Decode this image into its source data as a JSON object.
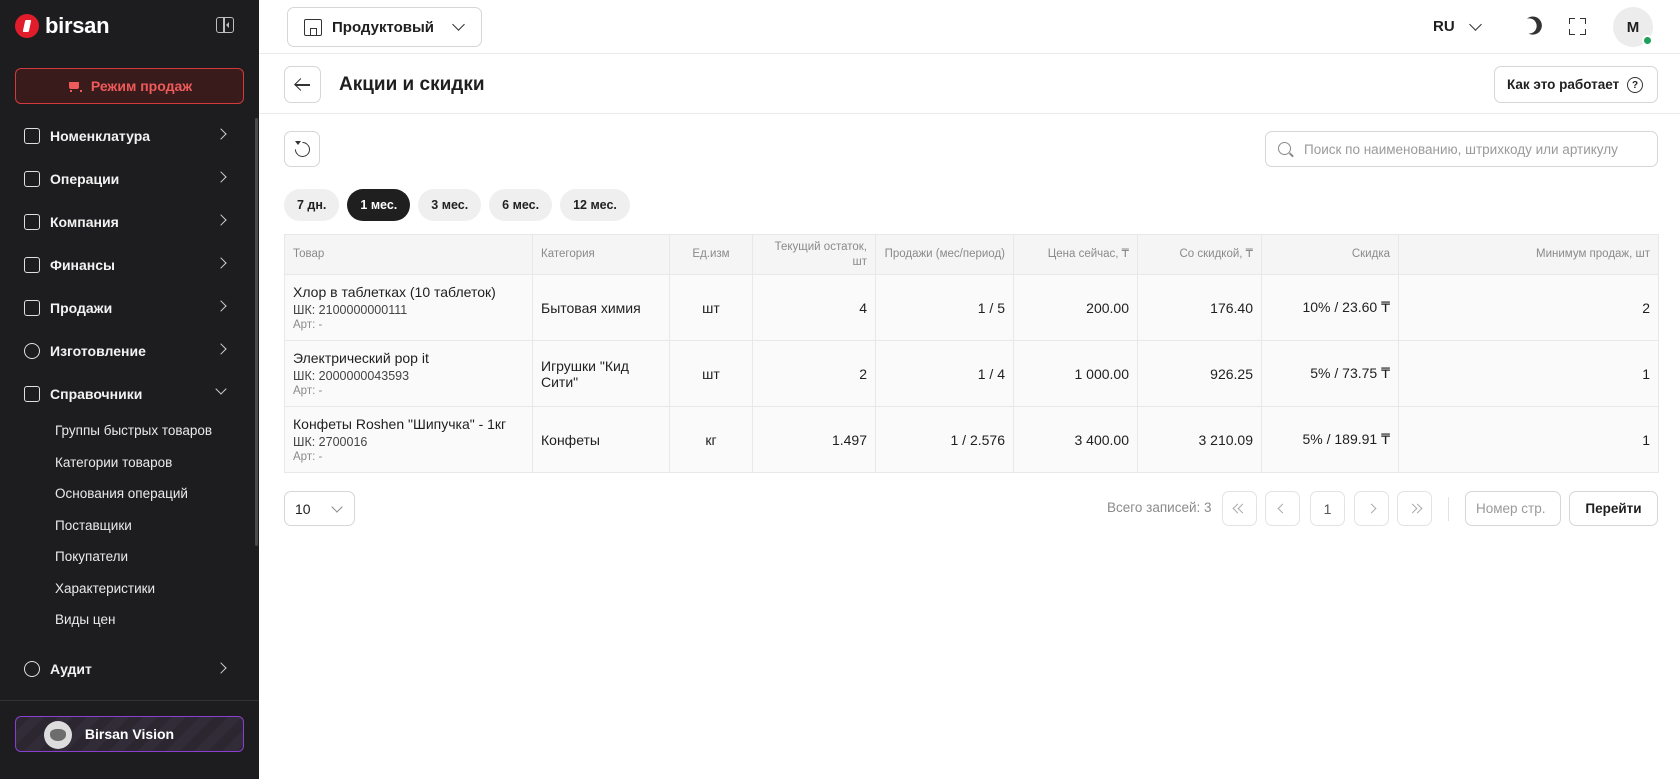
{
  "sidebar": {
    "logo": "birsan",
    "sales_mode": "Режим продаж",
    "menu": [
      {
        "label": "Номенклатура",
        "icon": "box-icon"
      },
      {
        "label": "Операции",
        "icon": "layers-icon"
      },
      {
        "label": "Компания",
        "icon": "briefcase-icon"
      },
      {
        "label": "Финансы",
        "icon": "wallet-icon"
      },
      {
        "label": "Продажи",
        "icon": "receipt-icon"
      },
      {
        "label": "Изготовление",
        "icon": "factory-icon"
      },
      {
        "label": "Справочники",
        "icon": "books-icon"
      }
    ],
    "submenu": [
      "Группы быстрых товаров",
      "Категории товаров",
      "Основания операций",
      "Поставщики",
      "Покупатели",
      "Характеристики",
      "Виды цен"
    ],
    "audit": "Аудит",
    "vision": "Birsan Vision"
  },
  "topbar": {
    "store": "Продуктовый",
    "language": "RU",
    "avatar_initial": "M"
  },
  "page": {
    "title": "Акции и скидки",
    "how_it_works": "Как это работает",
    "help_glyph": "?"
  },
  "search": {
    "placeholder": "Поиск по наименованию, штрихкоду или артикулу"
  },
  "periods": [
    "7 дн.",
    "1 мес.",
    "3 мес.",
    "6 мес.",
    "12 мес."
  ],
  "active_period": "1 мес.",
  "table": {
    "headers": [
      "Товар",
      "Категория",
      "Ед.изм",
      "Текущий остаток, шт",
      "Продажи (мес/период)",
      "Цена сейчас, ₸",
      "Со скидкой, ₸",
      "Скидка",
      "Минимум продаж, шт"
    ],
    "rows": [
      {
        "name": "Хлор в таблетках (10 таблеток)",
        "barcode": "ШК: 2100000000111",
        "article": "Арт: -",
        "category": "Бытовая химия",
        "unit": "шт",
        "stock": "4",
        "sales": "1 / 5",
        "price": "200.00",
        "discounted": "176.40",
        "discount": "10% / 23.60 ₸",
        "min_sales": "2"
      },
      {
        "name": "Электрический pop it",
        "barcode": "ШК: 2000000043593",
        "article": "Арт: -",
        "category": "Игрушки \"Кид Сити\"",
        "unit": "шт",
        "stock": "2",
        "sales": "1 / 4",
        "price": "1 000.00",
        "discounted": "926.25",
        "discount": "5% / 73.75 ₸",
        "min_sales": "1"
      },
      {
        "name": "Конфеты Roshen \"Шипучка\" - 1кг",
        "barcode": "ШК: 2700016",
        "article": "Арт: -",
        "category": "Конфеты",
        "unit": "кг",
        "stock": "1.497",
        "sales": "1 / 2.576",
        "price": "3 400.00",
        "discounted": "3 210.09",
        "discount": "5% / 189.91 ₸",
        "min_sales": "1"
      }
    ]
  },
  "pagination": {
    "page_size": "10",
    "total": "Всего записей: 3",
    "current_page": "1",
    "page_input_placeholder": "Номер стр.",
    "go": "Перейти"
  },
  "colors": {
    "sidebar_bg": "#1d1d1f",
    "accent_red": "#e11d2b",
    "vision_border": "#8a3fd1",
    "online": "#1fa05a"
  }
}
